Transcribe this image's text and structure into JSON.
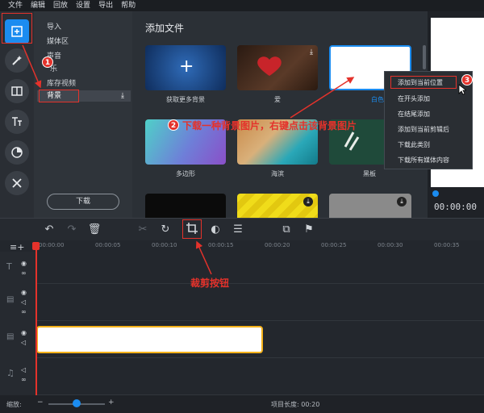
{
  "menu": [
    "文件",
    "编辑",
    "回放",
    "设置",
    "导出",
    "帮助"
  ],
  "rail": {
    "items": [
      {
        "icon": "add-file-icon"
      },
      {
        "icon": "magic-wand-icon"
      },
      {
        "icon": "transitions-icon"
      },
      {
        "icon": "titles-icon"
      },
      {
        "icon": "stickers-icon"
      },
      {
        "icon": "tools-icon"
      }
    ]
  },
  "categories": {
    "items": [
      "导入",
      "媒体区",
      "声音",
      "乐",
      "库存视频",
      "背景"
    ],
    "selected": "背景",
    "download_label": "下载"
  },
  "content": {
    "title": "添加文件",
    "thumbs": [
      {
        "label": "获取更多背景"
      },
      {
        "label": "爱"
      },
      {
        "label": "白色"
      },
      {
        "label": "多边形"
      },
      {
        "label": "海滨"
      },
      {
        "label": "黑板"
      }
    ]
  },
  "context_menu": {
    "items": [
      "添加到当前位置",
      "在开头添加",
      "在结尾添加",
      "添加到当前剪辑后",
      "下载此类别",
      "下载所有媒体内容"
    ]
  },
  "preview": {
    "time": "00:00:00"
  },
  "ruler": [
    "00:00:00",
    "00:00:05",
    "00:00:10",
    "00:00:15",
    "00:00:20",
    "00:00:25",
    "00:00:30",
    "00:00:35"
  ],
  "status": {
    "zoom_label": "缩放:",
    "project_length_label": "项目长度: 00:20"
  },
  "annotations": {
    "step1": "1",
    "step2": "2",
    "step3": "3",
    "step2_text": "下载一种背景图片，右键点击该背景图片",
    "crop_text": "裁剪按钮"
  },
  "colors": {
    "accent": "#1b8cf0",
    "annotation": "#e4322b",
    "clip_border": "#f5b21b"
  }
}
